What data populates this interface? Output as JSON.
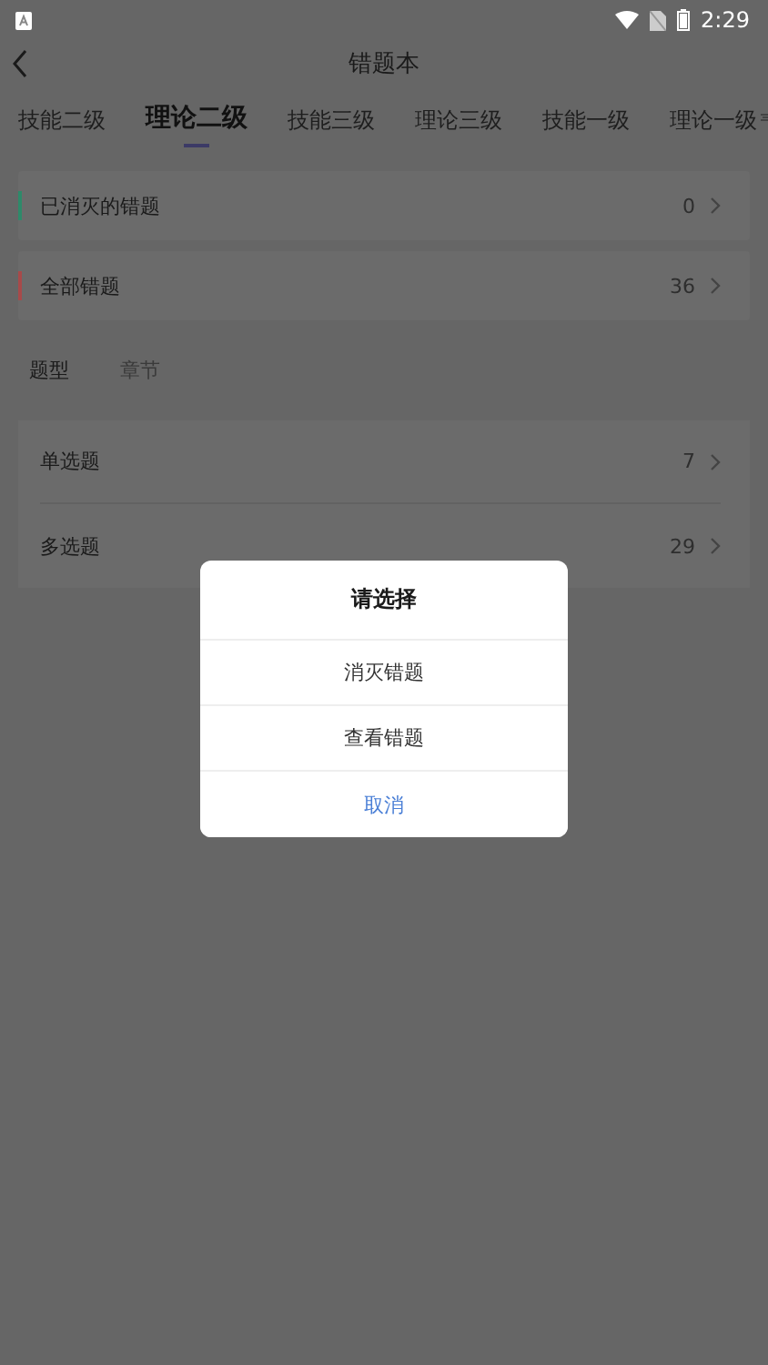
{
  "status_bar": {
    "time": "2:29"
  },
  "header": {
    "title": "错题本"
  },
  "level_tabs": [
    {
      "label": "技能二级",
      "selected": false
    },
    {
      "label": "理论二级",
      "selected": true
    },
    {
      "label": "技能三级",
      "selected": false
    },
    {
      "label": "理论三级",
      "selected": false
    },
    {
      "label": "技能一级",
      "selected": false
    },
    {
      "label": "理论一级",
      "selected": false
    }
  ],
  "summary": [
    {
      "label": "已消灭的错题",
      "count": "0",
      "color": "#2e8a6a"
    },
    {
      "label": "全部错题",
      "count": "36",
      "color": "#a84a4a"
    }
  ],
  "group_tabs": [
    {
      "label": "题型",
      "selected": true
    },
    {
      "label": "章节",
      "selected": false
    }
  ],
  "categories": [
    {
      "label": "单选题",
      "count": "7"
    },
    {
      "label": "多选题",
      "count": "29"
    }
  ],
  "dialog": {
    "title": "请选择",
    "options": [
      {
        "label": "消灭错题",
        "kind": "option"
      },
      {
        "label": "查看错题",
        "kind": "option"
      },
      {
        "label": "取消",
        "kind": "cancel"
      }
    ]
  }
}
